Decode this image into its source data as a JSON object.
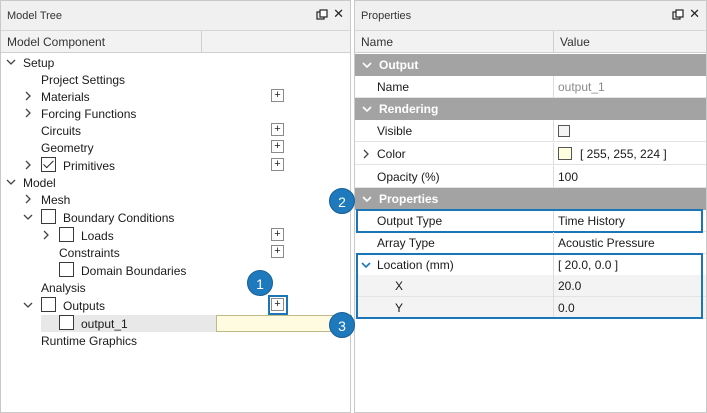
{
  "model_tree": {
    "title": "Model Tree",
    "column_header": "Model Component",
    "items": [
      {
        "label": "Setup"
      },
      {
        "label": "Project Settings"
      },
      {
        "label": "Materials"
      },
      {
        "label": "Forcing Functions"
      },
      {
        "label": "Circuits"
      },
      {
        "label": "Geometry"
      },
      {
        "label": "Primitives"
      },
      {
        "label": "Model"
      },
      {
        "label": "Mesh"
      },
      {
        "label": "Boundary Conditions"
      },
      {
        "label": "Loads"
      },
      {
        "label": "Constraints"
      },
      {
        "label": "Domain Boundaries"
      },
      {
        "label": "Analysis"
      },
      {
        "label": "Outputs"
      },
      {
        "label": "output_1"
      },
      {
        "label": "Runtime Graphics"
      }
    ],
    "add_button_label": "+"
  },
  "properties": {
    "title": "Properties",
    "col_name": "Name",
    "col_value": "Value",
    "rows": [
      {
        "name": "Output",
        "value": ""
      },
      {
        "name": "Name",
        "value": "output_1"
      },
      {
        "name": "Rendering",
        "value": ""
      },
      {
        "name": "Visible",
        "value": ""
      },
      {
        "name": "Color",
        "value": "[ 255, 255, 224 ]"
      },
      {
        "name": "Opacity (%)",
        "value": "100"
      },
      {
        "name": "Properties",
        "value": ""
      },
      {
        "name": "Output Type",
        "value": "Time History"
      },
      {
        "name": "Array Type",
        "value": "Acoustic Pressure"
      },
      {
        "name": "Location (mm)",
        "value": "[ 20.0, 0.0 ]"
      },
      {
        "name": "X",
        "value": "20.0"
      },
      {
        "name": "Y",
        "value": "0.0"
      }
    ]
  },
  "callouts": [
    "1",
    "2",
    "3"
  ],
  "icons": {
    "pin": "pin-icon",
    "close": "close-icon",
    "expand": "chevron-right-icon",
    "collapse": "chevron-down-icon"
  },
  "colors": {
    "accent": "#1e79bd",
    "category": "#a3a3a3",
    "color_swatch": "#ffffe0"
  }
}
